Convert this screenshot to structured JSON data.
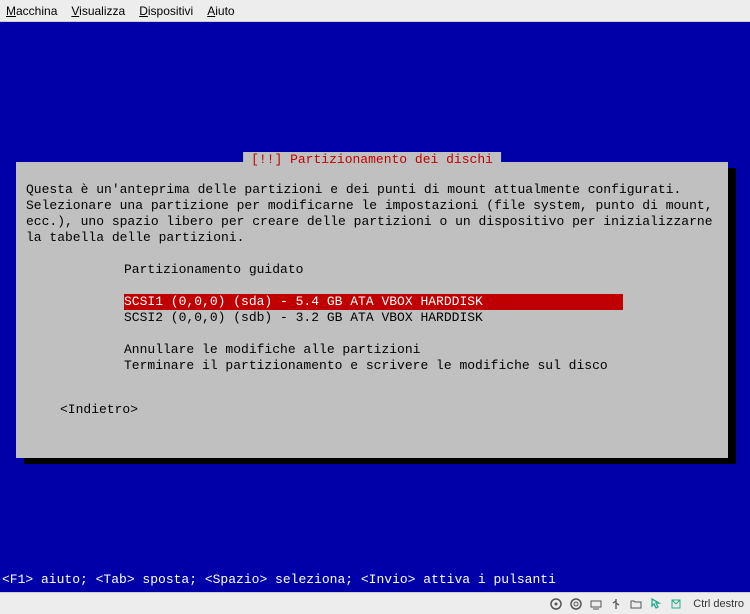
{
  "menubar": {
    "items": [
      {
        "letter": "M",
        "rest": "acchina"
      },
      {
        "letter": "V",
        "rest": "isualizza"
      },
      {
        "letter": "D",
        "rest": "ispositivi"
      },
      {
        "letter": "A",
        "rest": "iuto"
      }
    ]
  },
  "dialog": {
    "title": "[!!] Partizionamento dei dischi",
    "body": "Questa è un'anteprima delle partizioni e dei punti di mount attualmente configurati.\nSelezionare una partizione per modificarne le impostazioni (file system, punto di mount,\necc.), uno spazio libero per creare delle partizioni o un dispositivo per inizializzarne\nla tabella delle partizioni.",
    "items": [
      {
        "label": "Partizionamento guidato",
        "group": 0
      },
      {
        "label": "SCSI1 (0,0,0) (sda) - 5.4 GB ATA VBOX HARDDISK",
        "group": 1,
        "selected": true
      },
      {
        "label": "SCSI2 (0,0,0) (sdb) - 3.2 GB ATA VBOX HARDDISK",
        "group": 1
      },
      {
        "label": "Annullare le modifiche alle partizioni",
        "group": 2
      },
      {
        "label": "Terminare il partizionamento e scrivere le modifiche sul disco",
        "group": 2
      }
    ],
    "back": "<Indietro>"
  },
  "fkeys": "<F1> aiuto; <Tab> sposta; <Spazio> seleziona; <Invio> attiva i pulsanti",
  "statusbar": {
    "label": "Ctrl destro"
  }
}
